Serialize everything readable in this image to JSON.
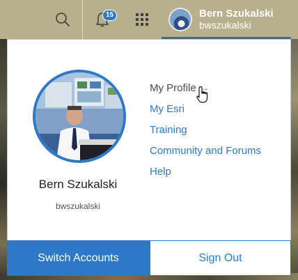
{
  "header": {
    "notifications_count": "15",
    "user_full_name": "Bern Szukalski",
    "user_handle": "bwszukalski",
    "icons": [
      "search-icon",
      "bell-icon",
      "apps-grid-icon"
    ]
  },
  "profile": {
    "display_name": "Bern Szukalski",
    "username": "bwszukalski"
  },
  "links": [
    {
      "label": "My Profile",
      "active": true,
      "icon": "external-arrow-icon"
    },
    {
      "label": "My Esri"
    },
    {
      "label": "Training"
    },
    {
      "label": "Community and Forums"
    },
    {
      "label": "Help"
    }
  ],
  "actions": {
    "switch_accounts": "Switch Accounts",
    "sign_out": "Sign Out"
  },
  "colors": {
    "accent": "#2d79c7",
    "header_bg": "#b8b08c"
  }
}
